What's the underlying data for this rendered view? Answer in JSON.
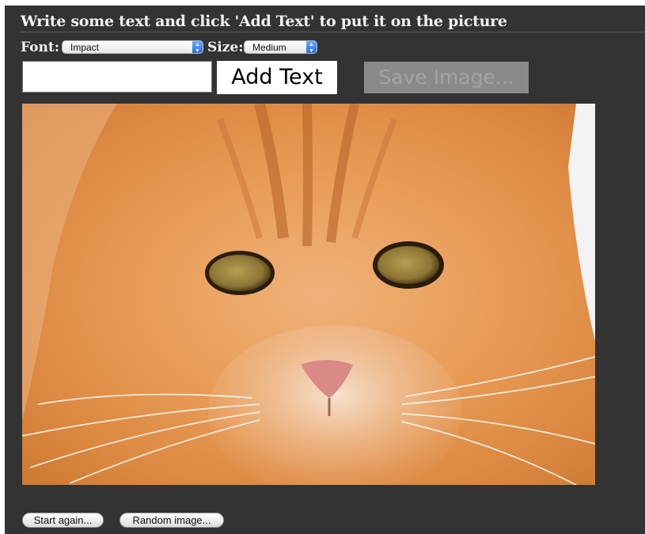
{
  "instruction": "Write some text and click 'Add Text' to put it on the picture",
  "font_option": {
    "label": "Font:",
    "selected": "Impact"
  },
  "size_option": {
    "label": "Size:",
    "selected": "Medium"
  },
  "text_input": {
    "value": "",
    "placeholder": ""
  },
  "add_text_button": "Add Text",
  "save_image_button": "Save Image...",
  "image": {
    "subject": "orange-tabby-cat-face"
  },
  "start_again_button": "Start again...",
  "random_image_button": "Random image...",
  "colors": {
    "panel": "#333333",
    "save_disabled": "#8a8a8a"
  }
}
